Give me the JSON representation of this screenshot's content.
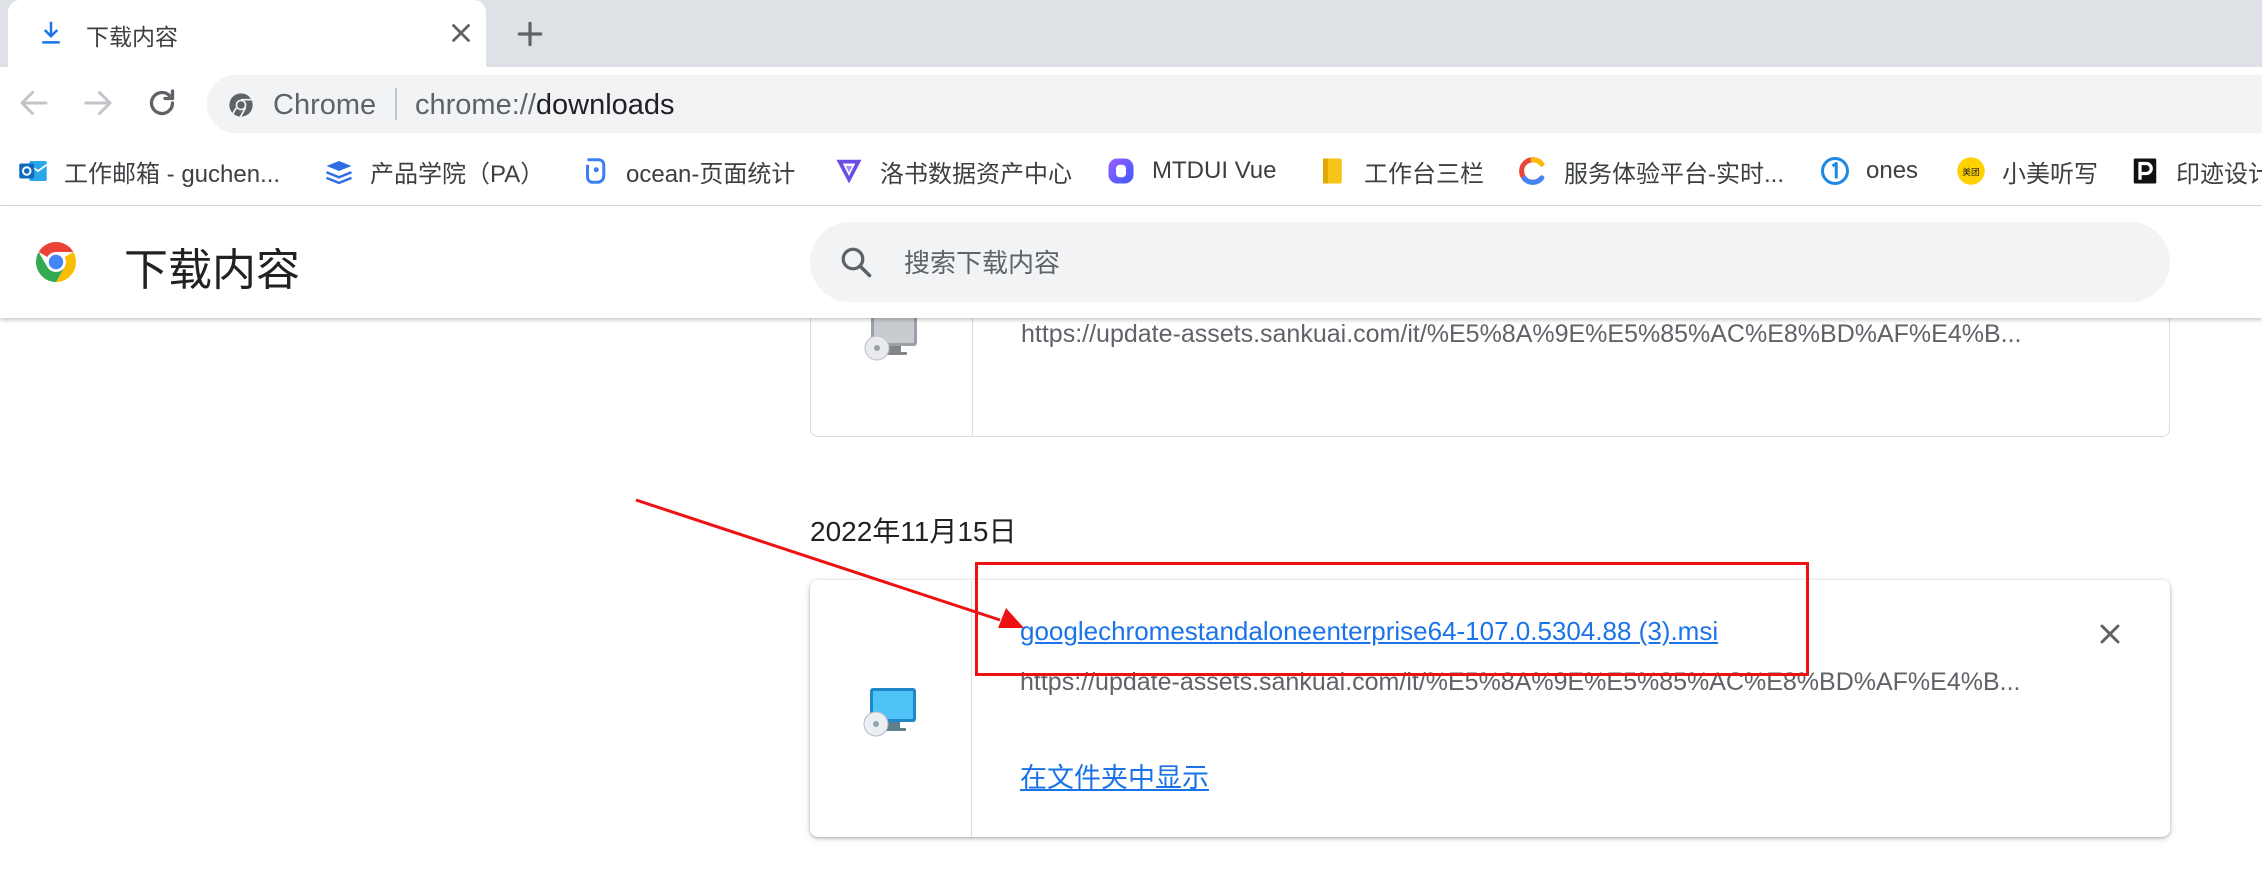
{
  "window": {
    "tab": {
      "title": "下载内容",
      "icon": "download-icon"
    },
    "new_tab_icon": "plus-icon"
  },
  "toolbar": {
    "omnibox": {
      "chip_label": "Chrome",
      "url_scheme": "chrome://",
      "url_path": "downloads"
    }
  },
  "bookmarks": [
    {
      "label": "工作邮箱 - guchen...",
      "icon": "outlook-icon",
      "color": "#0f6cbd"
    },
    {
      "label": "产品学院（PA）",
      "icon": "stack-icon",
      "color": "#2f6ee4"
    },
    {
      "label": "ocean-页面统计",
      "icon": "ocean-icon",
      "color": "#3d7ef7"
    },
    {
      "label": "洛书数据资产中心",
      "icon": "luoshu-icon",
      "color": "#6b4ce6"
    },
    {
      "label": "MTDUI Vue",
      "icon": "mtdui-icon",
      "color": "#6a3df0"
    },
    {
      "label": "工作台三栏",
      "icon": "folder-icon",
      "color": "#f5c518"
    },
    {
      "label": "服务体验平台-实时...",
      "icon": "c-logo-icon",
      "color": "#e8453c"
    },
    {
      "label": "ones",
      "icon": "ones-icon",
      "color": "#1e88e5"
    },
    {
      "label": "小美听写",
      "icon": "meituan-icon",
      "color": "#ffd100"
    },
    {
      "label": "印迹设计",
      "icon": "yinji-icon",
      "color": "#111111"
    }
  ],
  "downloads_page": {
    "title": "下载内容",
    "search_placeholder": "搜索下载内容",
    "items_above": [
      {
        "url": "https://update-assets.sankuai.com/it/%E5%8A%9E%E5%85%AC%E8%BD%AF%E4%B..."
      }
    ],
    "groups": [
      {
        "date": "2022年11月15日",
        "items": [
          {
            "file_name": "googlechromestandaloneenterprise64-107.0.5304.88 (3).msi",
            "url": "https://update-assets.sankuai.com/it/%E5%8A%9E%E5%85%AC%E8%BD%AF%E4%B...",
            "action": "在文件夹中显示"
          }
        ]
      }
    ]
  },
  "colors": {
    "link": "#1a73e8",
    "annotation": "#ee1111",
    "tabstrip": "#dee1e6"
  }
}
